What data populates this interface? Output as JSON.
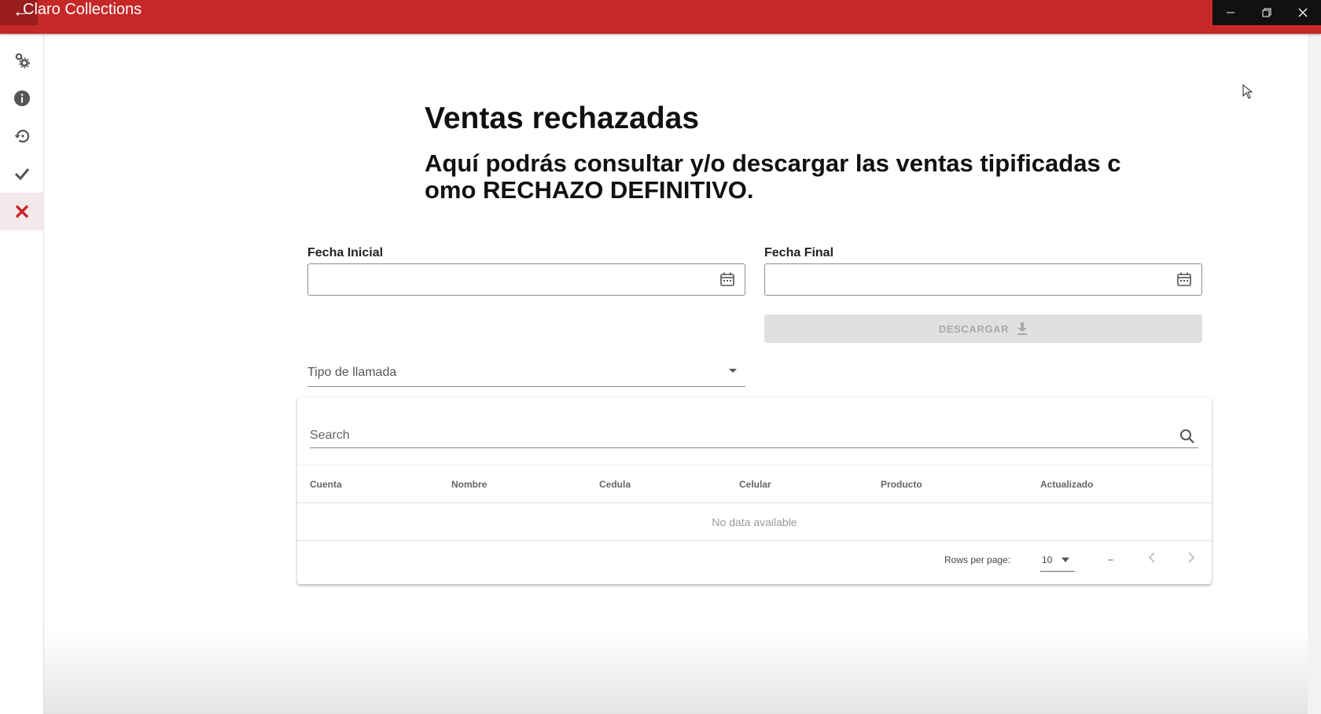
{
  "window": {
    "title": "Claro Collections",
    "back_icon": "arrow-left-icon",
    "title_bar_color": "#c62828"
  },
  "sidebar": {
    "items": [
      {
        "icon": "settings-gears-icon",
        "active": false
      },
      {
        "icon": "info-icon",
        "active": false
      },
      {
        "icon": "history-icon",
        "active": false
      },
      {
        "icon": "check-icon",
        "active": false
      },
      {
        "icon": "close-icon",
        "active": true,
        "color": "#c62828"
      }
    ]
  },
  "page": {
    "title": "Ventas rechazadas",
    "subtitle": "Aquí podrás consultar y/o descargar las ventas tipificadas como RECHAZO DEFINITIVO."
  },
  "filters": {
    "fecha_inicial_label": "Fecha Inicial",
    "fecha_inicial_value": "",
    "fecha_final_label": "Fecha Final",
    "fecha_final_value": "",
    "tipo_llamada_placeholder": "Tipo de llamada",
    "download_label": "DESCARGAR"
  },
  "table": {
    "search_placeholder": "Search",
    "columns": [
      "Cuenta",
      "Nombre",
      "Cedula",
      "Celular",
      "Producto",
      "Actualizado"
    ],
    "empty_text": "No data available",
    "rows_per_page_label": "Rows per page:",
    "rows_per_page_value": "10",
    "page_range": "–"
  }
}
